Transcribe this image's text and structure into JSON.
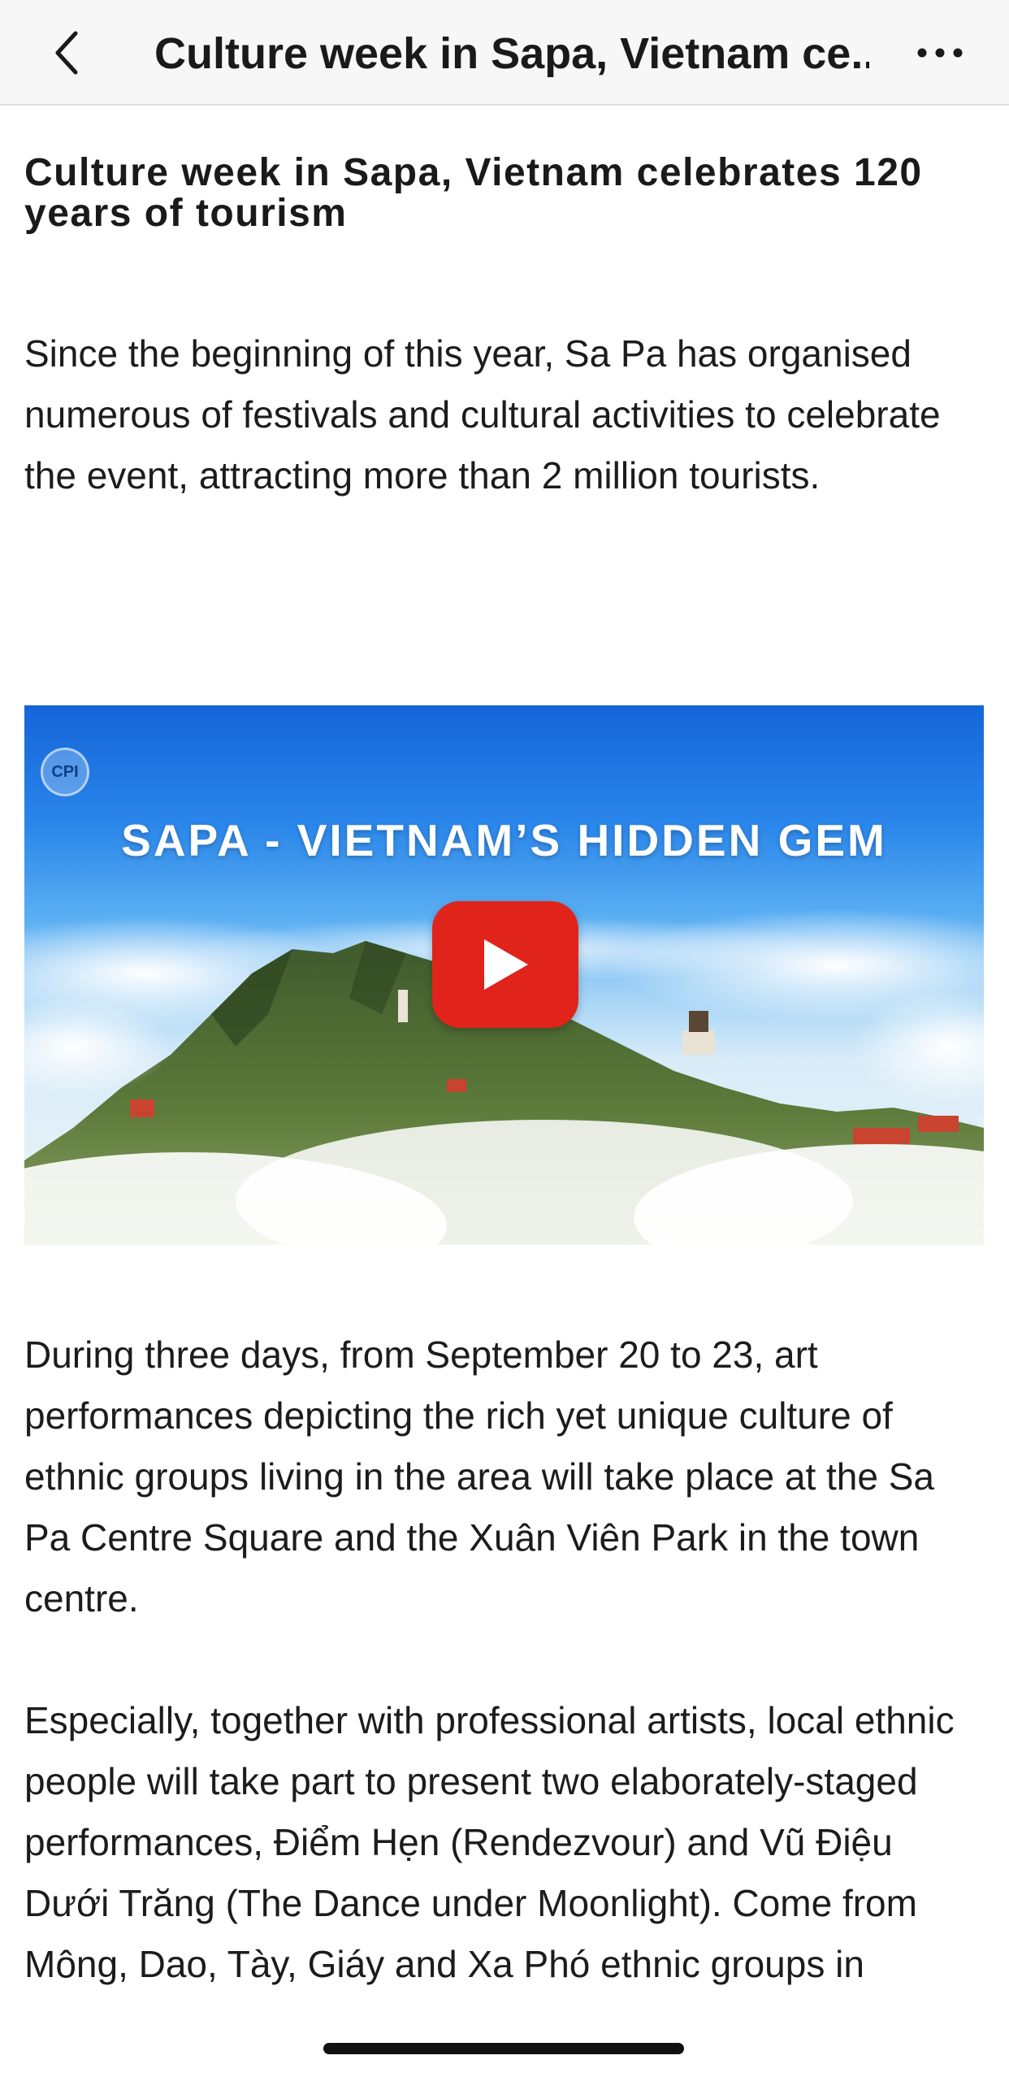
{
  "nav": {
    "title": "Culture week in Sapa, Vietnam ce...",
    "back_icon": "chevron-left-icon",
    "more_icon": "ellipsis-icon"
  },
  "article": {
    "title": "Culture week in Sapa, Vietnam celebrates 120 years of tourism",
    "paragraphs": [
      "Since the beginning of this year, Sa Pa has organised numerous of festivals and cultural activities to celebrate the event, attracting more than 2 million tourists.",
      "During three days, from September 20 to 23, art performances depicting the rich yet unique culture of ethnic groups living in the area will take place at the Sa Pa Centre Square and the Xuân Viên Park in the town centre.",
      "Especially, together with professional artists, local ethnic people will take part to present two elaborately-staged performances, Điểm Hẹn (Rendezvour) and Vũ Điệu Dưới Trăng (The Dance under Moonlight). Come from Mông, Dao, Tày, Giáy and Xa Phó ethnic groups in"
    ],
    "video": {
      "headline": "SAPA - VIETNAM’S HIDDEN GEM",
      "channel_logo": "CPI",
      "play_icon": "play-icon",
      "play_color": "#e0241c"
    }
  },
  "colors": {
    "nav_background": "#f7f7f7",
    "text": "#1c1c1c",
    "sky_top": "#1565d8"
  }
}
